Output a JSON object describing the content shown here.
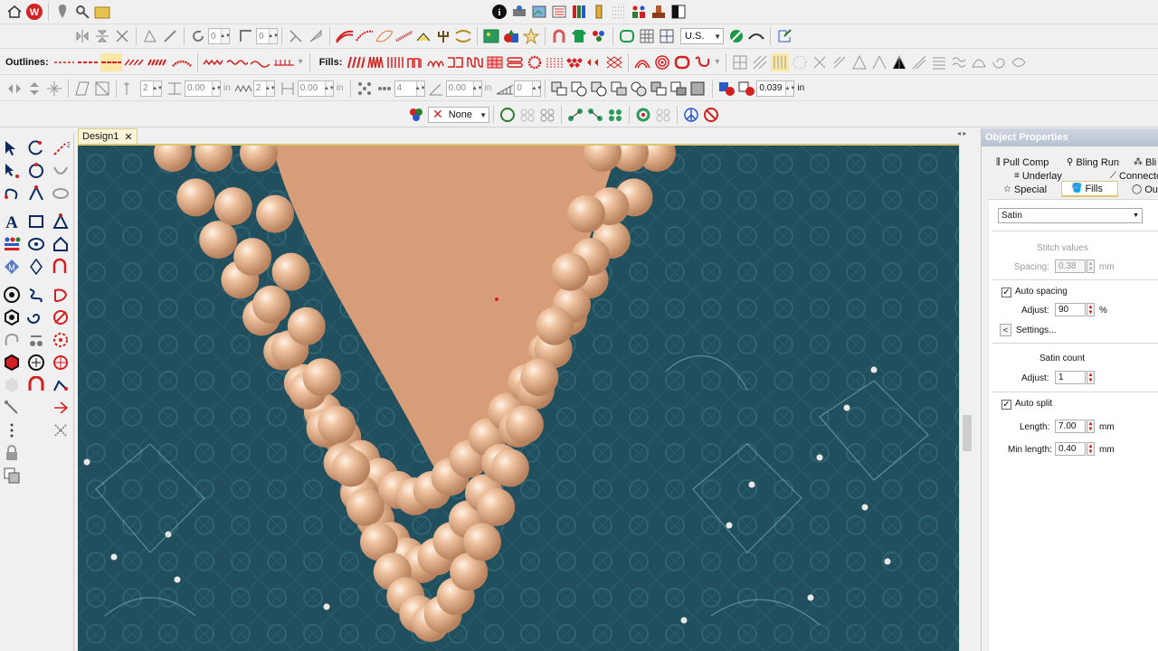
{
  "toolbar2": {
    "rotate_value": "0",
    "skew_value": "0",
    "region_code": "U.S."
  },
  "toolbar3": {
    "outlines_label": "Outlines:",
    "fills_label": "Fills:"
  },
  "toolbar4": {
    "v1": "2",
    "v2": "0.00",
    "unit1": "in",
    "v3": "2",
    "v4": "0.00",
    "unit2": "in",
    "v5": "4",
    "v6": "0.00",
    "unit3": "in",
    "v7": "0",
    "v8": "0.039",
    "unit4": "in"
  },
  "toolbar5": {
    "color_none": "None"
  },
  "document": {
    "tab_label": "Design1",
    "close": "✕"
  },
  "properties": {
    "title": "Object Properties",
    "tabs_row1": [
      "Pull Comp",
      "Bling Run",
      "Bli"
    ],
    "tabs_row2": [
      "Underlay",
      "Connecto"
    ],
    "tabs_row3": [
      "Special",
      "Fills",
      "Out"
    ],
    "fill_type": "Satin",
    "stitch_values_label": "Stitch values",
    "spacing_label": "Spacing:",
    "spacing_value": "0.38",
    "spacing_unit": "mm",
    "auto_spacing_label": "Auto spacing",
    "adjust_label": "Adjust:",
    "adjust_value": "90",
    "adjust_unit": "%",
    "settings_label": "Settings...",
    "satin_count_label": "Satin count",
    "adjust2_label": "Adjust:",
    "adjust2_value": "1",
    "auto_split_label": "Auto split",
    "length_label": "Length:",
    "length_value": "7.00",
    "length_unit": "mm",
    "min_length_label": "Min length:",
    "min_length_value": "0.40",
    "min_length_unit": "mm"
  },
  "colors": {
    "accent_red": "#d42020",
    "canvas_bg": "#1f4c5a",
    "pearl": "#e9b48e",
    "skin": "#d79c78",
    "tab_gold": "#e0c56f"
  }
}
